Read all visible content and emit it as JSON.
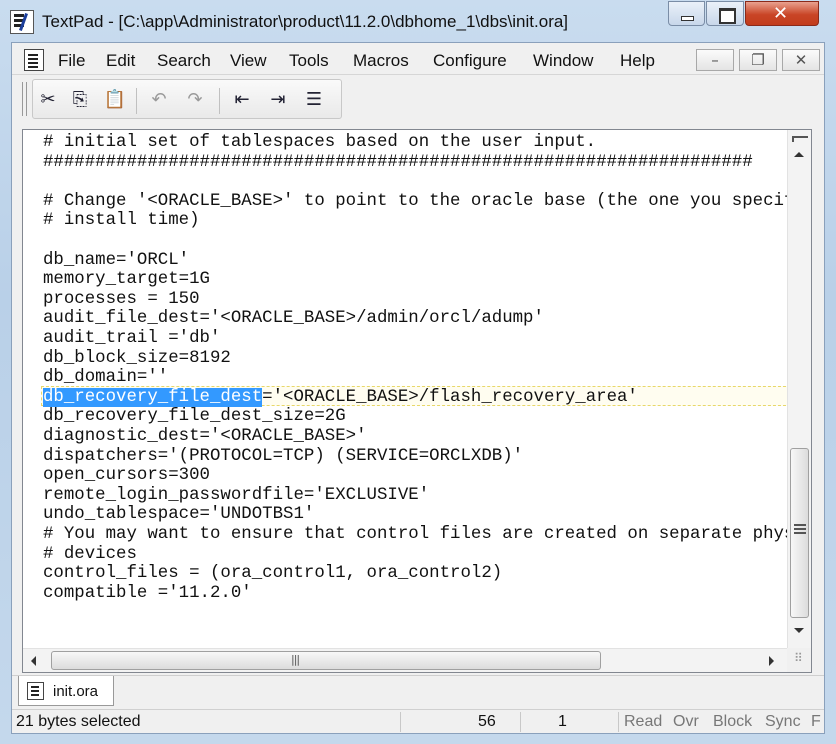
{
  "window": {
    "title": "TextPad - [C:\\app\\Administrator\\product\\11.2.0\\dbhome_1\\dbs\\init.ora]"
  },
  "menu": {
    "items": [
      "File",
      "Edit",
      "Search",
      "View",
      "Tools",
      "Macros",
      "Configure",
      "Window",
      "Help"
    ]
  },
  "toolbar": {
    "buttons": [
      "cut-icon",
      "copy-icon",
      "paste-icon",
      "undo-icon",
      "redo-icon",
      "indent-decrease-icon",
      "indent-increase-icon",
      "format-icon"
    ]
  },
  "editor": {
    "lines": [
      "# initial set of tablespaces based on the user input.",
      "####################################################################",
      "",
      "# Change '<ORACLE_BASE>' to point to the oracle base (the one you specify at",
      "# install time)",
      "",
      "db_name='ORCL'",
      "memory_target=1G",
      "processes = 150",
      "audit_file_dest='<ORACLE_BASE>/admin/orcl/adump'",
      "audit_trail ='db'",
      "db_block_size=8192",
      "db_domain=''",
      "='<ORACLE_BASE>/flash_recovery_area'",
      "db_recovery_file_dest_size=2G",
      "diagnostic_dest='<ORACLE_BASE>'",
      "dispatchers='(PROTOCOL=TCP) (SERVICE=ORCLXDB)'",
      "open_cursors=300",
      "remote_login_passwordfile='EXCLUSIVE'",
      "undo_tablespace='UNDOTBS1'",
      "# You may want to ensure that control files are created on separate physical",
      "# devices",
      "control_files = (ora_control1, ora_control2)",
      "compatible ='11.2.0'"
    ],
    "selected_text": "db_recovery_file_dest"
  },
  "file_tabs": [
    {
      "label": "init.ora"
    }
  ],
  "status": {
    "message": "21 bytes selected",
    "line": "56",
    "column": "1",
    "read": "Read",
    "ovr": "Ovr",
    "block": "Block",
    "sync": "Sync",
    "rec": "F"
  }
}
